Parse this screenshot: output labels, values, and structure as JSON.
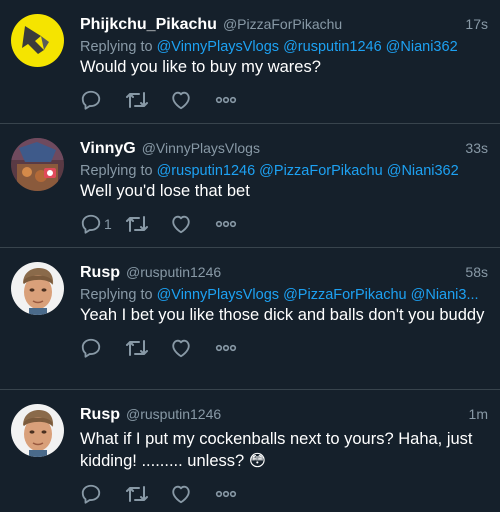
{
  "tweets": [
    {
      "name": "Phijkchu_Pikachu",
      "handle": "@PizzaForPikachu",
      "time": "17s",
      "reply_prefix": "Replying to",
      "mentions": [
        "@VinnyPlaysVlogs",
        "@rusputin1246",
        "@Niani362"
      ],
      "text": "Would you like to buy my wares?",
      "reply_count": "",
      "avatar": "yellow-pikachu-avatar"
    },
    {
      "name": "VinnyG",
      "handle": "@VinnyPlaysVlogs",
      "time": "33s",
      "reply_prefix": "Replying to",
      "mentions": [
        "@rusputin1246",
        "@PizzaForPikachu",
        "@Niani362"
      ],
      "text": "Well you'd lose that bet",
      "reply_count": "1",
      "avatar": "photo-avatar"
    },
    {
      "name": "Rusp",
      "handle": "@rusputin1246",
      "time": "58s",
      "reply_prefix": "Replying to",
      "mentions": [
        "@VinnyPlaysVlogs",
        "@PizzaForPikachu",
        "@Niani3..."
      ],
      "text": "Yeah I bet you like those dick and balls don't you buddy",
      "reply_count": "",
      "avatar": "face-avatar"
    },
    {
      "name": "Rusp",
      "handle": "@rusputin1246",
      "time": "1m",
      "text": "What if I put my cockenballs next to yours? Haha, just kidding! ......... unless? 😳",
      "reply_count": "",
      "avatar": "face-avatar"
    }
  ],
  "colors": {
    "background": "#15202b",
    "divider": "#38444d",
    "secondary_text": "#8899a6",
    "mention": "#1da1f2"
  },
  "icons": [
    "reply-icon",
    "retweet-icon",
    "like-icon",
    "more-icon"
  ]
}
